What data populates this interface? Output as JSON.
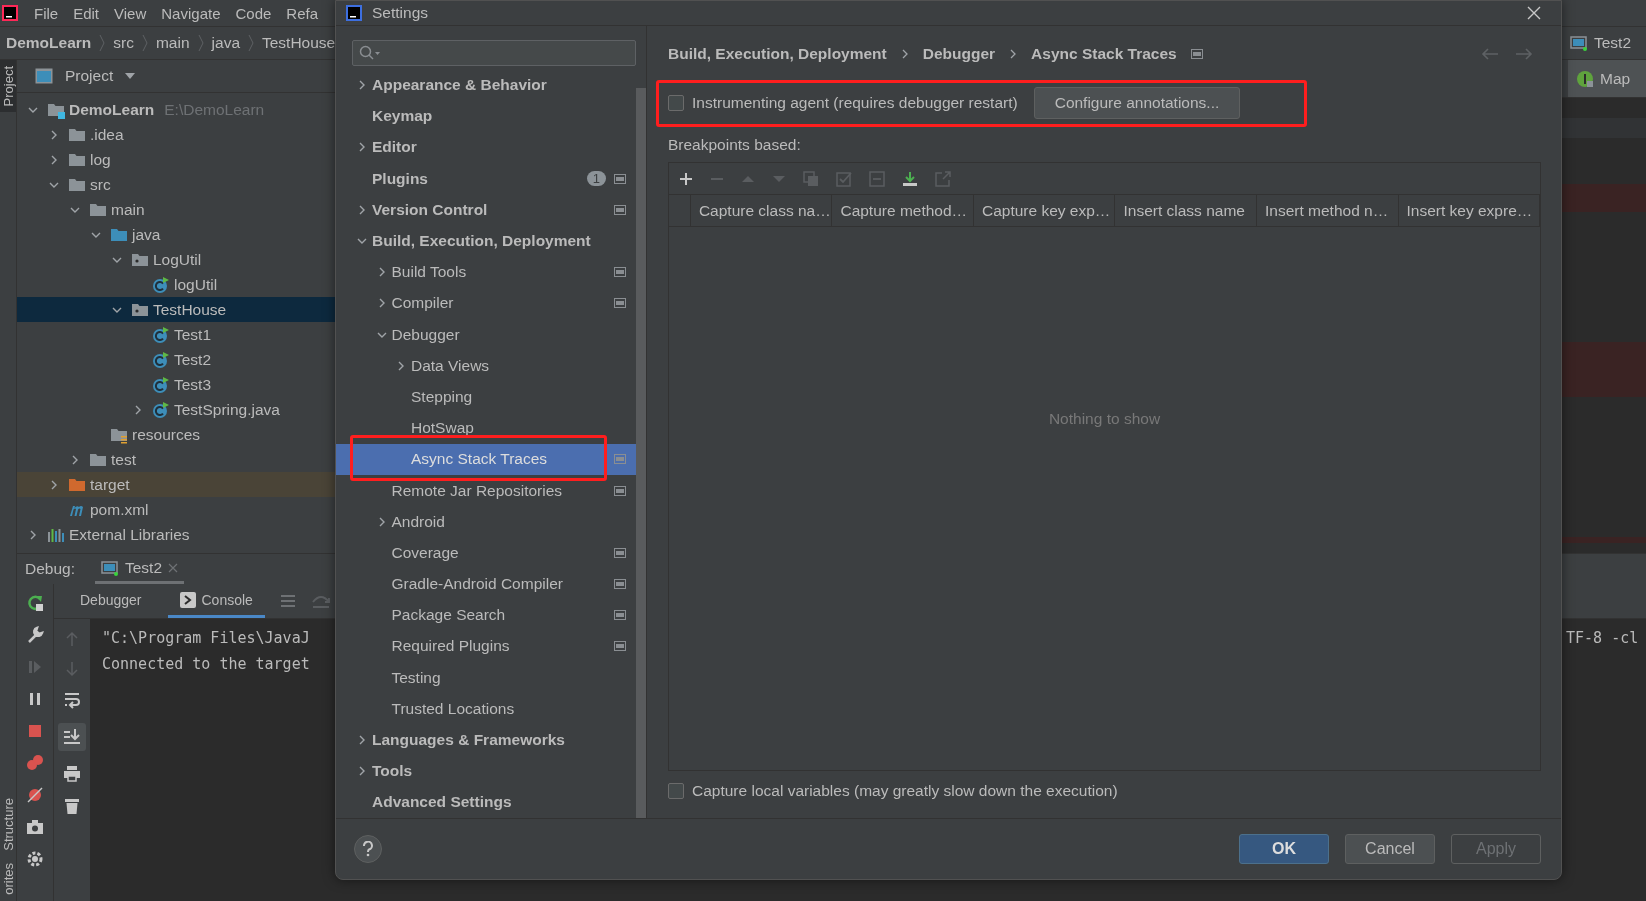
{
  "menu_bar": {
    "items": [
      "File",
      "Edit",
      "View",
      "Navigate",
      "Code",
      "Refa"
    ]
  },
  "nav_bar": {
    "breadcrumbs": [
      "DemoLearn",
      "src",
      "main",
      "java",
      "TestHouse"
    ],
    "run_config": "Test2"
  },
  "side_tabs": {
    "top": "Project",
    "bottom": [
      "Structure",
      "orites"
    ]
  },
  "project_panel": {
    "title": "Project",
    "tree": [
      {
        "label": "DemoLearn",
        "path": "E:\\DemoLearn",
        "kind": "module",
        "expanded": true,
        "selected": false,
        "children": [
          {
            "label": ".idea",
            "kind": "folder",
            "expanded": false,
            "selected": false
          },
          {
            "label": "log",
            "kind": "folder",
            "expanded": false,
            "selected": false
          },
          {
            "label": "src",
            "kind": "folder",
            "expanded": true,
            "selected": false,
            "children": [
              {
                "label": "main",
                "kind": "folder",
                "expanded": true,
                "selected": false,
                "children": [
                  {
                    "label": "java",
                    "kind": "source",
                    "expanded": true,
                    "selected": false,
                    "children": [
                      {
                        "label": "LogUtil",
                        "kind": "package",
                        "expanded": true,
                        "selected": false,
                        "children": [
                          {
                            "label": "logUtil",
                            "kind": "class",
                            "selected": false
                          }
                        ]
                      },
                      {
                        "label": "TestHouse",
                        "kind": "package",
                        "expanded": true,
                        "selected": true,
                        "children": [
                          {
                            "label": "Test1",
                            "kind": "class",
                            "selected": false
                          },
                          {
                            "label": "Test2",
                            "kind": "class",
                            "selected": false
                          },
                          {
                            "label": "Test3",
                            "kind": "class",
                            "selected": false
                          },
                          {
                            "label": "TestSpring.java",
                            "kind": "class",
                            "expanded": false,
                            "selected": false
                          }
                        ]
                      }
                    ]
                  },
                  {
                    "label": "resources",
                    "kind": "resources",
                    "selected": false
                  }
                ]
              },
              {
                "label": "test",
                "kind": "folder",
                "expanded": false,
                "selected": false
              }
            ]
          },
          {
            "label": "target",
            "kind": "excluded",
            "expanded": false,
            "selected": false
          },
          {
            "label": "pom.xml",
            "kind": "maven",
            "selected": false
          }
        ]
      },
      {
        "label": "External Libraries",
        "kind": "libraries",
        "expanded": false,
        "selected": false
      }
    ]
  },
  "editor": {
    "tab": "Map"
  },
  "debug_panel": {
    "label": "Debug:",
    "session": "Test2",
    "tabs": [
      {
        "label": "Debugger",
        "selected": false
      },
      {
        "label": "Console",
        "selected": true
      }
    ],
    "console_lines": [
      "\"C:\\Program Files\\JavaJ",
      "Connected to the target"
    ],
    "console_fragment": "TF-8 -cl"
  },
  "settings_dialog": {
    "title": "Settings",
    "tree": [
      {
        "label": "Appearance & Behavior",
        "expanded": false,
        "selected": false,
        "project_level": false
      },
      {
        "label": "Keymap",
        "selected": false,
        "project_level": false
      },
      {
        "label": "Editor",
        "expanded": false,
        "selected": false,
        "project_level": false
      },
      {
        "label": "Plugins",
        "badge": "1",
        "selected": false,
        "project_level": true
      },
      {
        "label": "Version Control",
        "expanded": false,
        "selected": false,
        "project_level": true
      },
      {
        "label": "Build, Execution, Deployment",
        "expanded": true,
        "selected": false,
        "project_level": false,
        "children": [
          {
            "label": "Build Tools",
            "expanded": false,
            "selected": false,
            "project_level": true
          },
          {
            "label": "Compiler",
            "expanded": false,
            "selected": false,
            "project_level": true
          },
          {
            "label": "Debugger",
            "expanded": true,
            "selected": false,
            "project_level": false,
            "children": [
              {
                "label": "Data Views",
                "expanded": false,
                "selected": false,
                "project_level": false
              },
              {
                "label": "Stepping",
                "selected": false,
                "project_level": false
              },
              {
                "label": "HotSwap",
                "selected": false,
                "project_level": false
              },
              {
                "label": "Async Stack Traces",
                "selected": true,
                "project_level": true
              }
            ]
          },
          {
            "label": "Remote Jar Repositories",
            "selected": false,
            "project_level": true
          },
          {
            "label": "Android",
            "expanded": false,
            "selected": false,
            "project_level": false
          },
          {
            "label": "Coverage",
            "selected": false,
            "project_level": true
          },
          {
            "label": "Gradle-Android Compiler",
            "selected": false,
            "project_level": true
          },
          {
            "label": "Package Search",
            "selected": false,
            "project_level": true
          },
          {
            "label": "Required Plugins",
            "selected": false,
            "project_level": true
          },
          {
            "label": "Testing",
            "selected": false,
            "project_level": false
          },
          {
            "label": "Trusted Locations",
            "selected": false,
            "project_level": false
          }
        ]
      },
      {
        "label": "Languages & Frameworks",
        "expanded": false,
        "selected": false,
        "project_level": false
      },
      {
        "label": "Tools",
        "expanded": false,
        "selected": false,
        "project_level": false
      },
      {
        "label": "Advanced Settings",
        "selected": false,
        "project_level": false
      }
    ],
    "breadcrumbs": [
      "Build, Execution, Deployment",
      "Debugger",
      "Async Stack Traces"
    ],
    "agent": {
      "label": "Instrumenting agent (requires debugger restart)",
      "checked": false
    },
    "configure_button": "Configure annotations...",
    "section_label": "Breakpoints based:",
    "columns": [
      "Capture class na…",
      "Capture method…",
      "Capture key exp…",
      "Insert class name",
      "Insert method n…",
      "Insert key expre…"
    ],
    "empty_text": "Nothing to show",
    "local_vars": {
      "label": "Capture local variables (may greatly slow down the execution)",
      "checked": false
    },
    "buttons": [
      {
        "label": "OK",
        "default": true,
        "disabled": false
      },
      {
        "label": "Cancel",
        "default": false,
        "disabled": false
      },
      {
        "label": "Apply",
        "default": false,
        "disabled": true
      }
    ]
  }
}
